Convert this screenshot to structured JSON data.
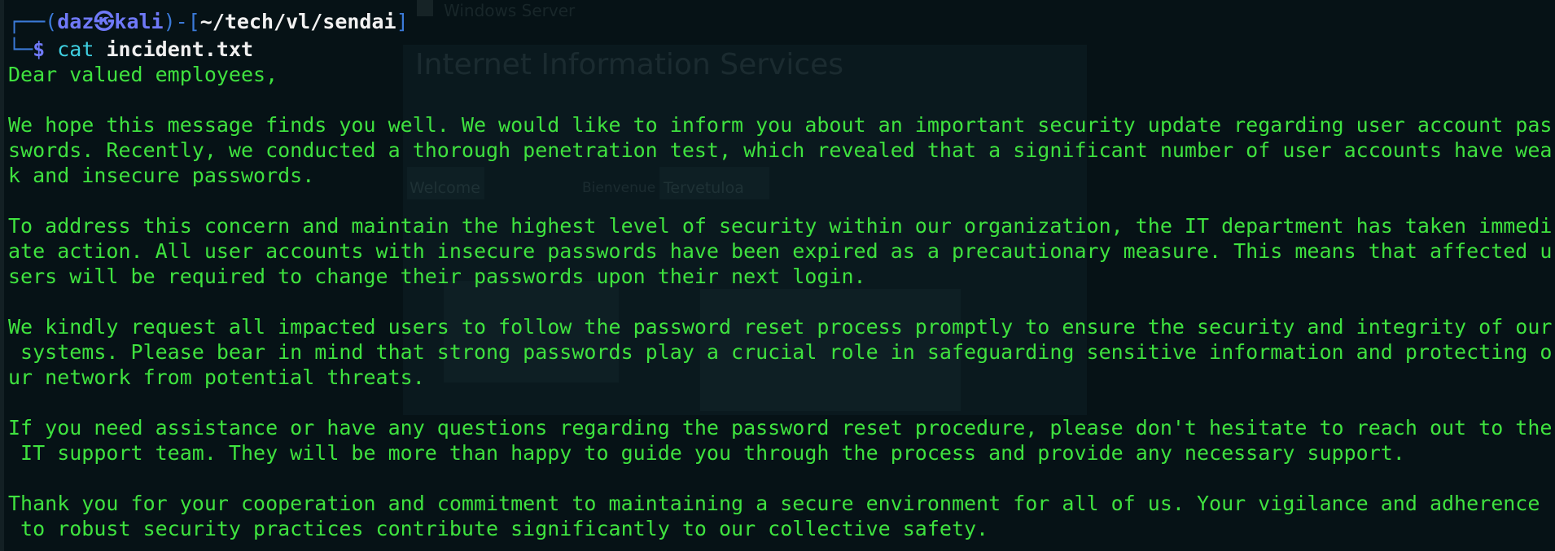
{
  "background": {
    "window_caption": "Windows Server",
    "title": "Internet Information Services",
    "tiles": [
      "Welcome",
      "Bienvenue",
      "Tervetuloa"
    ]
  },
  "colors": {
    "background": "#061216",
    "text": "#3fe23f",
    "prompt_blue": "#4f8df5",
    "prompt_user": "#6f79f8",
    "command": "#3fcfe0"
  },
  "prompt": {
    "box_top": "┌──(",
    "user": "daz",
    "skull": "㉿",
    "host": "kali",
    "sep": ")-[",
    "path": "~/tech/vl/sendai",
    "close": "]",
    "box_bottom": "└─",
    "dollar": "$",
    "command": "cat",
    "argument": "incident.txt"
  },
  "file_lines": [
    "Dear valued employees,",
    "",
    "We hope this message finds you well. We would like to inform you about an important security update regarding user account pas",
    "swords. Recently, we conducted a thorough penetration test, which revealed that a significant number of user accounts have wea",
    "k and insecure passwords.",
    "",
    "To address this concern and maintain the highest level of security within our organization, the IT department has taken immedi",
    "ate action. All user accounts with insecure passwords have been expired as a precautionary measure. This means that affected u",
    "sers will be required to change their passwords upon their next login.",
    "",
    "We kindly request all impacted users to follow the password reset process promptly to ensure the security and integrity of our",
    " systems. Please bear in mind that strong passwords play a crucial role in safeguarding sensitive information and protecting o",
    "ur network from potential threats.",
    "",
    "If you need assistance or have any questions regarding the password reset procedure, please don't hesitate to reach out to the",
    " IT support team. They will be more than happy to guide you through the process and provide any necessary support.",
    "",
    "Thank you for your cooperation and commitment to maintaining a secure environment for all of us. Your vigilance and adherence",
    " to robust security practices contribute significantly to our collective safety."
  ]
}
